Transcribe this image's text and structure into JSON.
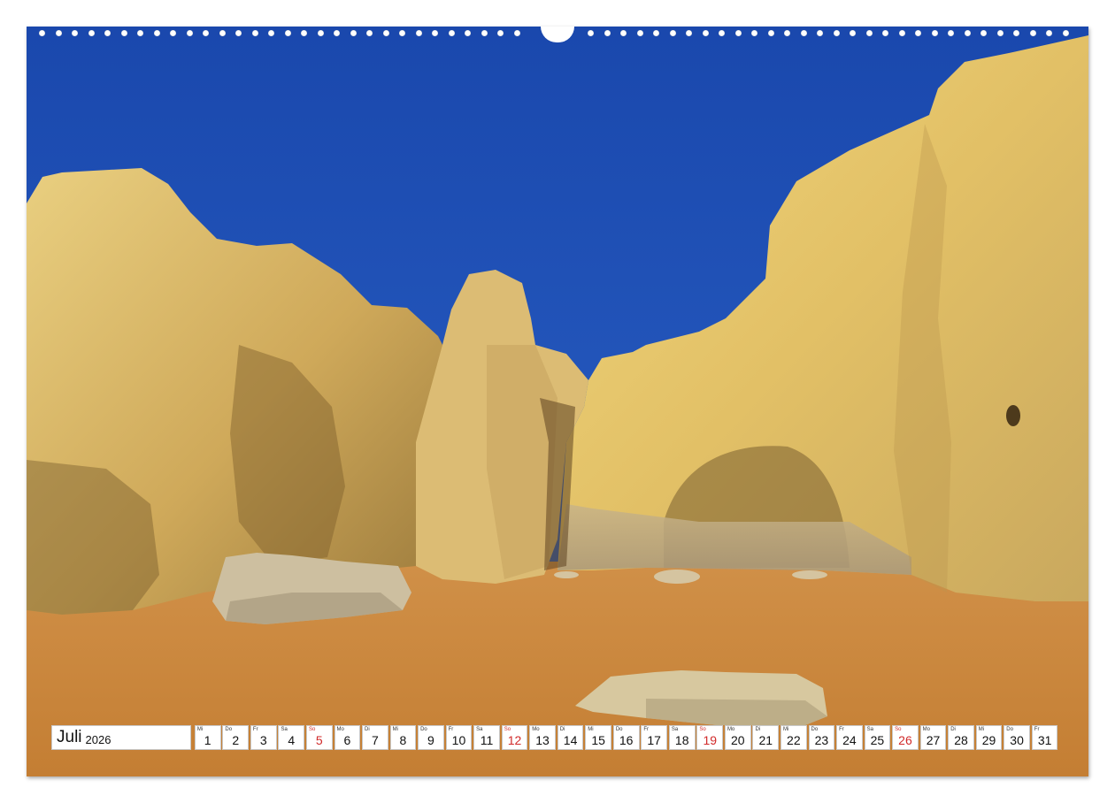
{
  "calendar": {
    "month": "Juli",
    "year": "2026",
    "sunday_color": "#d12a2a",
    "days": [
      {
        "dow": "Mi",
        "num": "1"
      },
      {
        "dow": "Do",
        "num": "2"
      },
      {
        "dow": "Fr",
        "num": "3"
      },
      {
        "dow": "Sa",
        "num": "4"
      },
      {
        "dow": "So",
        "num": "5"
      },
      {
        "dow": "Mo",
        "num": "6"
      },
      {
        "dow": "Di",
        "num": "7"
      },
      {
        "dow": "Mi",
        "num": "8"
      },
      {
        "dow": "Do",
        "num": "9"
      },
      {
        "dow": "Fr",
        "num": "10"
      },
      {
        "dow": "Sa",
        "num": "11"
      },
      {
        "dow": "So",
        "num": "12"
      },
      {
        "dow": "Mo",
        "num": "13"
      },
      {
        "dow": "Di",
        "num": "14"
      },
      {
        "dow": "Mi",
        "num": "15"
      },
      {
        "dow": "Do",
        "num": "16"
      },
      {
        "dow": "Fr",
        "num": "17"
      },
      {
        "dow": "Sa",
        "num": "18"
      },
      {
        "dow": "So",
        "num": "19"
      },
      {
        "dow": "Mo",
        "num": "20"
      },
      {
        "dow": "Di",
        "num": "21"
      },
      {
        "dow": "Mi",
        "num": "22"
      },
      {
        "dow": "Do",
        "num": "23"
      },
      {
        "dow": "Fr",
        "num": "24"
      },
      {
        "dow": "Sa",
        "num": "25"
      },
      {
        "dow": "So",
        "num": "26"
      },
      {
        "dow": "Mo",
        "num": "27"
      },
      {
        "dow": "Di",
        "num": "28"
      },
      {
        "dow": "Mi",
        "num": "29"
      },
      {
        "dow": "Do",
        "num": "30"
      },
      {
        "dow": "Fr",
        "num": "31"
      }
    ]
  },
  "photo": {
    "subject": "sandstone-cliffs-beach",
    "colors": {
      "sky": "#1f52b8",
      "cliff_light": "#e8cf7a",
      "cliff_mid": "#d4ad55",
      "cliff_shadow": "#8a6a32",
      "sand": "#cf8a3c"
    }
  }
}
